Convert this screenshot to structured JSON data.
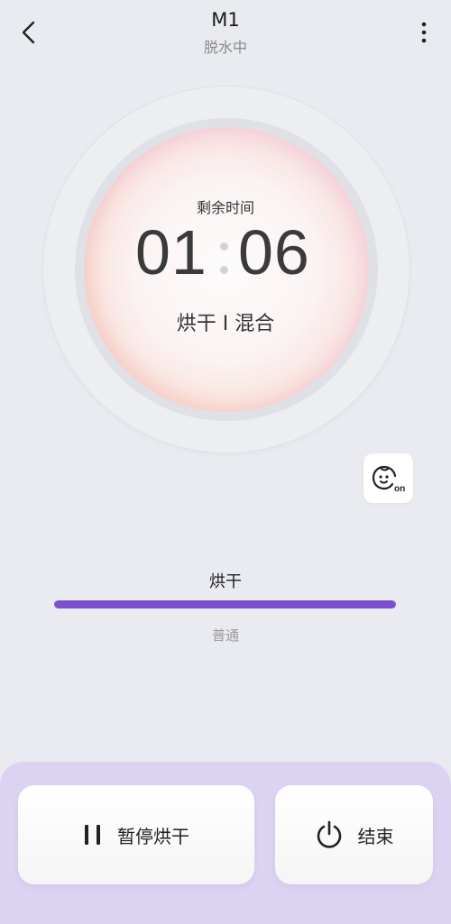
{
  "header": {
    "title": "M1",
    "subtitle": "脱水中",
    "back_icon": "chevron-left-icon",
    "more_icon": "more-vertical-icon"
  },
  "dial": {
    "remaining_label": "剩余时间",
    "hours": "01",
    "minutes": "06",
    "mode": "烘干 I 混合"
  },
  "child_lock": {
    "icon": "baby-face-icon",
    "state_label": "on"
  },
  "progress": {
    "stage": "烘干",
    "level": "普通",
    "fraction": 1.0,
    "color": "#7b4fcf"
  },
  "actions": {
    "pause_label": "暂停烘干",
    "pause_icon": "pause-icon",
    "end_label": "结束",
    "end_icon": "power-icon"
  },
  "colors": {
    "background": "#e9ebf0",
    "panel": "#dcd3f3",
    "accent": "#7b4fcf"
  }
}
